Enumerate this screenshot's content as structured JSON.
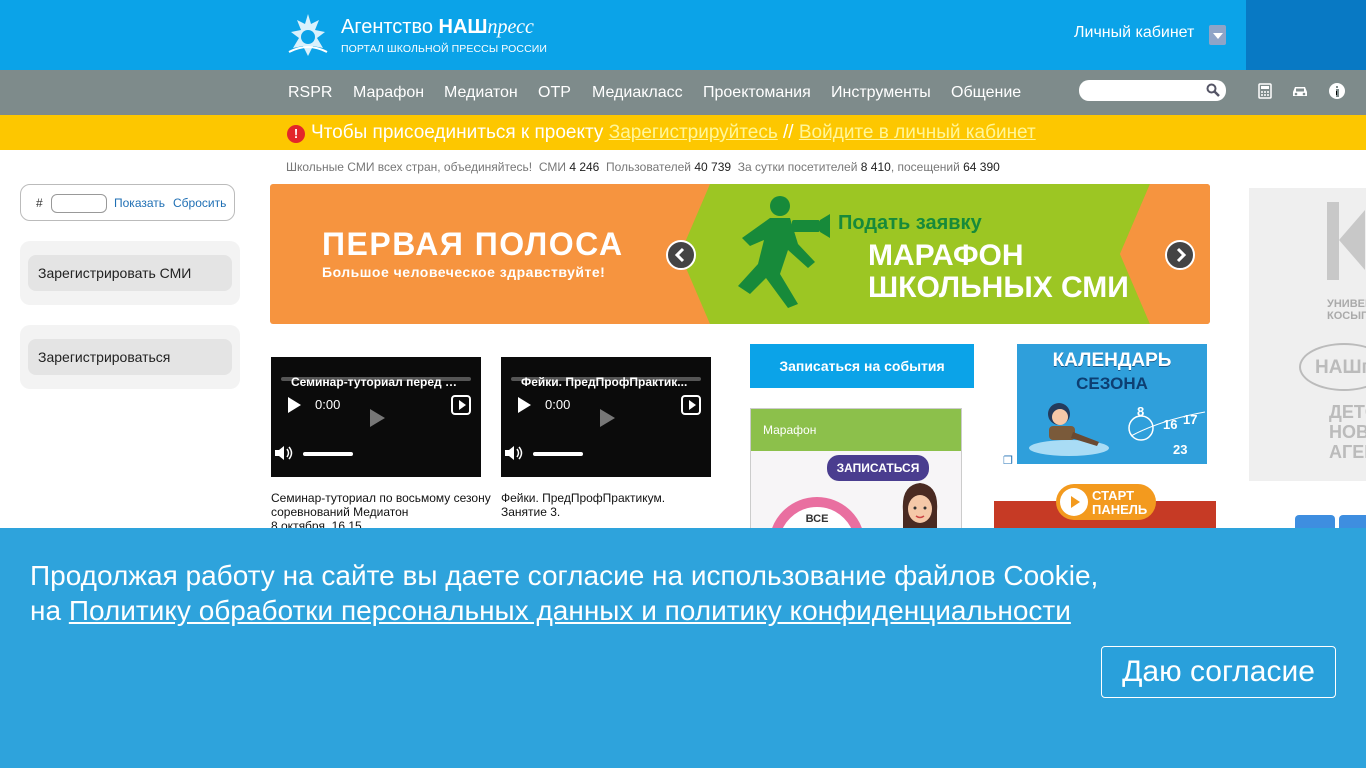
{
  "header": {
    "brand_prefix": "Агентство ",
    "brand_bold": "НАШ",
    "brand_italic": "пресс",
    "subtitle": "ПОРТАЛ ШКОЛЬНОЙ ПРЕССЫ РОССИИ",
    "cabinet_label": "Личный кабинет"
  },
  "nav": {
    "items": [
      "RSPR",
      "Марафон",
      "Медиатон",
      "ОТР",
      "Медиакласс",
      "Проектомания",
      "Инструменты",
      "Общение"
    ],
    "search_placeholder": "",
    "icons": [
      "calculator-icon",
      "car-icon",
      "info-icon"
    ]
  },
  "notice": {
    "text": "Чтобы присоединиться к проекту ",
    "register_link": "Зарегистрируйтесь",
    "separator": " // ",
    "login_link": "Войдите в личный кабинет"
  },
  "stats": {
    "slogan": "Школьные СМИ всех стран, объединяйтесь!",
    "media_label": "СМИ",
    "media_count": "4 246",
    "users_label": "Пользователей",
    "users_count": "40 739",
    "day_label": "За сутки посетителей",
    "day_visitors": "8 410",
    "visits_label": ", посещений",
    "visits": "64 390"
  },
  "filter": {
    "hash": "#",
    "show": "Показать",
    "reset": "Сбросить"
  },
  "sidebar": {
    "register_media": "Зарегистрировать СМИ",
    "register": "Зарегистрироваться"
  },
  "banner": {
    "title": "ПЕРВАЯ ПОЛОСА",
    "subtitle": "Большое человеческое здравствуйте!",
    "cta": "Подать заявку",
    "big_line1": "МАРАФОН",
    "big_line2": "ШКОЛЬНЫХ СМИ"
  },
  "videos": [
    {
      "title": "Семинар-туториал перед н...",
      "time": "0:00",
      "caption": "Семинар-туториал по восьмому сезону соревнований Медиатон\n8 октября, 16.15"
    },
    {
      "title": "Фейки. ПредПрофПрактик...",
      "time": "0:00",
      "caption": "Фейки. ПредПрофПрактикум. Занятие 3."
    }
  ],
  "events": {
    "button": "Записаться на события"
  },
  "marathon": {
    "header": "Марафон",
    "signup": "ЗАПИСАТЬСЯ",
    "badge": "ВСЕ"
  },
  "calendar": {
    "title": "КАЛЕНДАРЬ",
    "subtitle": "СЕЗОНА",
    "numbers": [
      "8",
      "16",
      "17",
      "23"
    ]
  },
  "start_panel": {
    "line1": "СТАРТ",
    "line2": "ПАНЕЛЬ"
  },
  "far_right": {
    "line1": "УНИВЕР",
    "line2": "КОСЫГ",
    "brand": "НАШп",
    "line3": "ДЕТСК",
    "line4": "НОВОСТ",
    "line5": "АГЕНТО"
  },
  "cookie": {
    "line1": "Продолжая работу на сайте вы даете согласие на использование файлов Cookie,",
    "line2_prefix": "на ",
    "policy_link": "Политику обработки персональных данных и политику конфиденциальности",
    "accept": "Даю согласие"
  },
  "colors": {
    "header": "#0ba3e8",
    "nav": "#7e8b8b",
    "notice": "#fdc700",
    "cookie": "#2ea3dc"
  }
}
